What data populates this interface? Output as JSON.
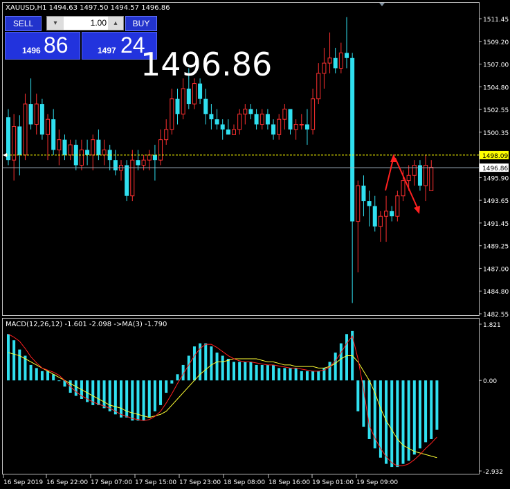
{
  "chart_data": [
    {
      "type": "candlestick",
      "header": "XAUUSD,H1  1494.63 1497.50 1494.57 1496.86",
      "y_ticks": [
        "1511.45",
        "1509.20",
        "1507.00",
        "1504.80",
        "1502.55",
        "1500.35",
        "1498.10",
        "1495.90",
        "1493.65",
        "1491.45",
        "1489.25",
        "1487.00",
        "1484.80",
        "1482.55"
      ],
      "y_range": [
        1482.55,
        1511.45
      ],
      "bid_line": {
        "value": 1496.86,
        "label": "1496.86"
      },
      "ask_line": {
        "value": 1498.09,
        "label": "1498.09"
      },
      "ohlc": [
        [
          1501.8,
          1502.6,
          1497.1,
          1497.6
        ],
        [
          1497.6,
          1502.1,
          1495.6,
          1500.9
        ],
        [
          1500.9,
          1502.0,
          1496.1,
          1498.1
        ],
        [
          1498.1,
          1504.1,
          1497.6,
          1503.1
        ],
        [
          1503.1,
          1505.6,
          1500.6,
          1501.1
        ],
        [
          1501.1,
          1504.1,
          1500.1,
          1503.1
        ],
        [
          1503.1,
          1503.6,
          1499.6,
          1500.1
        ],
        [
          1500.1,
          1502.1,
          1497.6,
          1501.6
        ],
        [
          1501.6,
          1502.6,
          1498.1,
          1498.6
        ],
        [
          1498.6,
          1500.6,
          1497.1,
          1499.6
        ],
        [
          1499.6,
          1500.1,
          1497.6,
          1498.1
        ],
        [
          1498.1,
          1499.6,
          1497.6,
          1499.1
        ],
        [
          1499.1,
          1499.6,
          1496.6,
          1497.1
        ],
        [
          1497.1,
          1499.6,
          1496.6,
          1498.6
        ],
        [
          1498.6,
          1499.6,
          1497.1,
          1498.1
        ],
        [
          1498.1,
          1500.1,
          1496.6,
          1499.6
        ],
        [
          1499.6,
          1500.6,
          1497.6,
          1498.1
        ],
        [
          1498.1,
          1499.6,
          1497.1,
          1498.6
        ],
        [
          1498.6,
          1499.1,
          1496.6,
          1497.6
        ],
        [
          1497.6,
          1498.6,
          1496.1,
          1496.6
        ],
        [
          1496.6,
          1497.6,
          1495.6,
          1497.1
        ],
        [
          1497.1,
          1497.6,
          1493.6,
          1494.1
        ],
        [
          1494.1,
          1498.6,
          1493.6,
          1497.6
        ],
        [
          1497.6,
          1498.6,
          1496.6,
          1497.1
        ],
        [
          1497.1,
          1498.1,
          1496.6,
          1497.6
        ],
        [
          1497.6,
          1498.6,
          1496.6,
          1498.1
        ],
        [
          1498.1,
          1499.1,
          1495.6,
          1497.6
        ],
        [
          1497.6,
          1500.6,
          1497.1,
          1499.6
        ],
        [
          1499.6,
          1501.6,
          1499.1,
          1500.6
        ],
        [
          1500.6,
          1504.6,
          1500.1,
          1503.6
        ],
        [
          1503.6,
          1504.6,
          1501.1,
          1502.1
        ],
        [
          1502.1,
          1505.6,
          1501.6,
          1504.6
        ],
        [
          1504.6,
          1506.6,
          1502.6,
          1503.1
        ],
        [
          1503.1,
          1505.6,
          1502.6,
          1505.1
        ],
        [
          1505.1,
          1505.6,
          1503.1,
          1503.6
        ],
        [
          1503.6,
          1504.6,
          1501.1,
          1502.1
        ],
        [
          1502.1,
          1503.1,
          1500.6,
          1501.6
        ],
        [
          1501.6,
          1502.6,
          1500.6,
          1501.1
        ],
        [
          1501.1,
          1501.6,
          1499.6,
          1500.6
        ],
        [
          1500.6,
          1501.6,
          1500.1,
          1500.1
        ],
        [
          1500.1,
          1501.1,
          1500.1,
          1500.6
        ],
        [
          1500.6,
          1502.6,
          1500.1,
          1502.1
        ],
        [
          1502.1,
          1503.1,
          1501.1,
          1502.6
        ],
        [
          1502.6,
          1503.1,
          1501.6,
          1502.1
        ],
        [
          1502.1,
          1502.6,
          1500.6,
          1501.1
        ],
        [
          1501.1,
          1502.6,
          1500.6,
          1502.1
        ],
        [
          1502.1,
          1502.6,
          1500.6,
          1501.1
        ],
        [
          1501.1,
          1501.6,
          1499.6,
          1500.1
        ],
        [
          1500.1,
          1502.1,
          1499.6,
          1501.6
        ],
        [
          1501.6,
          1503.1,
          1500.6,
          1502.6
        ],
        [
          1502.6,
          1502.6,
          1500.1,
          1500.6
        ],
        [
          1500.6,
          1501.6,
          1499.6,
          1501.1
        ],
        [
          1501.1,
          1502.1,
          1500.6,
          1501.1
        ],
        [
          1501.1,
          1502.6,
          1499.1,
          1500.6
        ],
        [
          1500.6,
          1504.6,
          1500.1,
          1503.6
        ],
        [
          1503.6,
          1507.1,
          1503.1,
          1506.1
        ],
        [
          1506.1,
          1508.6,
          1504.6,
          1507.1
        ],
        [
          1507.1,
          1510.1,
          1506.1,
          1507.6
        ],
        [
          1507.6,
          1508.6,
          1506.1,
          1506.6
        ],
        [
          1506.6,
          1509.1,
          1506.1,
          1508.1
        ],
        [
          1508.1,
          1511.6,
          1506.6,
          1507.6
        ],
        [
          1507.6,
          1508.1,
          1483.6,
          1491.6
        ],
        [
          1491.6,
          1495.6,
          1486.6,
          1495.1
        ],
        [
          1495.1,
          1496.1,
          1492.1,
          1493.6
        ],
        [
          1493.6,
          1494.6,
          1491.1,
          1493.1
        ],
        [
          1493.1,
          1494.1,
          1490.6,
          1491.1
        ],
        [
          1491.1,
          1492.6,
          1489.6,
          1492.1
        ],
        [
          1492.1,
          1494.1,
          1489.6,
          1492.6
        ],
        [
          1492.6,
          1493.1,
          1491.6,
          1492.1
        ],
        [
          1492.1,
          1494.6,
          1491.6,
          1494.1
        ],
        [
          1494.1,
          1496.6,
          1493.6,
          1495.6
        ],
        [
          1495.6,
          1497.1,
          1494.6,
          1496.1
        ],
        [
          1496.1,
          1497.6,
          1495.1,
          1497.1
        ],
        [
          1497.1,
          1497.6,
          1494.6,
          1495.1
        ],
        [
          1495.1,
          1498.1,
          1493.6,
          1497.1
        ],
        [
          1494.6,
          1497.6,
          1494.6,
          1496.9
        ]
      ]
    },
    {
      "type": "bar",
      "header": "MACD(12,26,12) -1.601 -2.098  ->MA(3) -1.790",
      "y_ticks": [
        "1.821",
        "0.00",
        "-2.932"
      ],
      "y_range": [
        -2.932,
        1.821
      ],
      "histogram": [
        1.5,
        1.3,
        1.0,
        0.8,
        0.5,
        0.4,
        0.3,
        0.3,
        0.2,
        0.0,
        -0.2,
        -0.4,
        -0.5,
        -0.6,
        -0.7,
        -0.8,
        -0.8,
        -0.9,
        -1.0,
        -1.1,
        -1.2,
        -1.2,
        -1.3,
        -1.3,
        -1.3,
        -1.2,
        -1.0,
        -0.8,
        -0.4,
        -0.1,
        0.2,
        0.5,
        0.8,
        1.1,
        1.2,
        1.2,
        1.1,
        0.9,
        0.8,
        0.7,
        0.6,
        0.6,
        0.6,
        0.6,
        0.5,
        0.5,
        0.5,
        0.5,
        0.4,
        0.4,
        0.4,
        0.4,
        0.3,
        0.3,
        0.3,
        0.3,
        0.4,
        0.6,
        0.9,
        1.2,
        1.5,
        1.6,
        -1.0,
        -1.5,
        -1.9,
        -2.2,
        -2.5,
        -2.7,
        -2.8,
        -2.8,
        -2.7,
        -2.6,
        -2.4,
        -2.2,
        -2.0,
        -1.9,
        -1.6
      ],
      "signal": [
        0.9,
        0.85,
        0.8,
        0.7,
        0.6,
        0.5,
        0.4,
        0.3,
        0.2,
        0.1,
        0.0,
        -0.1,
        -0.2,
        -0.3,
        -0.4,
        -0.5,
        -0.6,
        -0.7,
        -0.8,
        -0.85,
        -0.9,
        -1.0,
        -1.05,
        -1.1,
        -1.15,
        -1.2,
        -1.15,
        -1.1,
        -1.0,
        -0.8,
        -0.6,
        -0.4,
        -0.2,
        0.0,
        0.2,
        0.35,
        0.5,
        0.6,
        0.6,
        0.65,
        0.7,
        0.7,
        0.7,
        0.7,
        0.7,
        0.65,
        0.6,
        0.6,
        0.55,
        0.5,
        0.5,
        0.45,
        0.45,
        0.45,
        0.45,
        0.4,
        0.4,
        0.45,
        0.55,
        0.7,
        0.8,
        0.8,
        0.6,
        0.3,
        0.0,
        -0.4,
        -0.9,
        -1.3,
        -1.6,
        -1.9,
        -2.1,
        -2.2,
        -2.3,
        -2.35,
        -2.4,
        -2.45,
        -2.5
      ]
    }
  ],
  "trade_panel": {
    "sell_label": "SELL",
    "buy_label": "BUY",
    "lot_value": "1.00",
    "sell_small": "1496",
    "sell_big": "86",
    "buy_small": "1497",
    "buy_big": "24",
    "big_price": "1496.86"
  },
  "time_labels": [
    "16 Sep 2019",
    "16 Sep 22:00",
    "17 Sep 07:00",
    "17 Sep 15:00",
    "17 Sep 23:00",
    "18 Sep 08:00",
    "18 Sep 16:00",
    "19 Sep 01:00",
    "19 Sep 09:00"
  ],
  "colors": {
    "bull": "#ff3030",
    "bear": "#30e0f0",
    "signal_line": "#ffff33",
    "macd_line": "#ff2020",
    "ask_line": "#ffff00",
    "bid_line": "#a0b0c0",
    "arrows": "#ff2020"
  }
}
